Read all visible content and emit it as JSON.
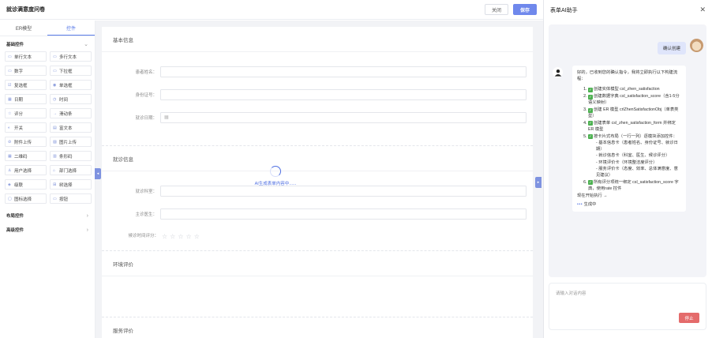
{
  "header": {
    "title": "就诊满意度问卷",
    "close_label": "关闭",
    "save_label": "保存"
  },
  "sidebar": {
    "tabs": [
      "ER模型",
      "控件"
    ],
    "active_tab": "控件",
    "basic_section": "基础控件",
    "controls": [
      {
        "icon": "▭",
        "label": "单行文本"
      },
      {
        "icon": "▭",
        "label": "多行文本"
      },
      {
        "icon": "▭",
        "label": "数字"
      },
      {
        "icon": "▭",
        "label": "下拉框"
      },
      {
        "icon": "☑",
        "label": "复选框"
      },
      {
        "icon": "◉",
        "label": "单选框"
      },
      {
        "icon": "▦",
        "label": "日期"
      },
      {
        "icon": "◷",
        "label": "时间"
      },
      {
        "icon": "☆",
        "label": "评分"
      },
      {
        "icon": "→",
        "label": "滑动条"
      },
      {
        "icon": "◐",
        "label": "开关"
      },
      {
        "icon": "▤",
        "label": "富文本"
      },
      {
        "icon": "⊘",
        "label": "附件上传"
      },
      {
        "icon": "▨",
        "label": "图片上传"
      },
      {
        "icon": "▦",
        "label": "二维码"
      },
      {
        "icon": "▥",
        "label": "条形码"
      },
      {
        "icon": "♙",
        "label": "用户选择"
      },
      {
        "icon": "⌂",
        "label": "部门选择"
      },
      {
        "icon": "◈",
        "label": "级联"
      },
      {
        "icon": "⊞",
        "label": "树选择"
      },
      {
        "icon": "▢",
        "label": "图标选择"
      },
      {
        "icon": "▭",
        "label": "按钮"
      }
    ],
    "layout_section": "布局控件",
    "advanced_section": "高级控件"
  },
  "canvas": {
    "sections": {
      "basic": "基本信息",
      "visit": "就诊信息",
      "environment": "环境评价",
      "service": "服务评价"
    },
    "fields": {
      "patient_name": "患者姓名：",
      "id_number": "身份证号：",
      "visit_date": "就诊日期：",
      "department": "就诊科室：",
      "doctor": "主诊医生：",
      "wait_rating": "候诊时间评分："
    },
    "loading_text": "AI生成表单内容中......"
  },
  "assistant": {
    "title": "表单AI助手",
    "user_message": "确认创建",
    "reply_intro": "好的，已收到您的确认指令，我将立即执行以下构建流程：",
    "steps": [
      "创建实体模型 csl_zhen_satisfaction",
      "创建数据字典 csl_satisfaction_score（含1-5分语义映射）",
      "创建 ER 模型 crlZhenSatisfactionObj（单表类型）",
      "创建表单 csl_zhen_satisfaction_form 并绑定 ER 模型",
      "按卡片式布局（一行一列）逐模块添加控件：",
      "所有评分项统一绑定 csl_satisfaction_score 字典，使用rate 控件"
    ],
    "step5_details": [
      "- 基本信息卡（患者姓名、身份证号、就诊日期）",
      "- 就诊信息卡（科室、医生、候诊评分）",
      "- 环境评价卡（环境整洁度评分）",
      "- 服务评价卡（态度、效率、总体满意度、意见建议）"
    ],
    "executing": "现在开始执行 →",
    "generating": "生成中",
    "input_placeholder": "请输入对话内容",
    "stop_label": "停止"
  }
}
